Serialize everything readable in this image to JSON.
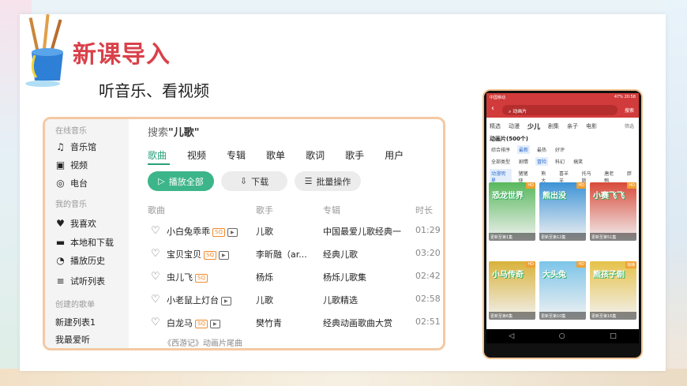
{
  "slide": {
    "title": "新课导入",
    "subtitle": "听音乐、看视频"
  },
  "music_app": {
    "sidebar": {
      "section_online": "在线音乐",
      "online_items": [
        {
          "label": "音乐馆",
          "icon": "music-note-icon"
        },
        {
          "label": "视频",
          "icon": "video-icon"
        },
        {
          "label": "电台",
          "icon": "radio-icon"
        }
      ],
      "section_mine": "我的音乐",
      "mine_items": [
        {
          "label": "我喜欢",
          "icon": "heart-icon"
        },
        {
          "label": "本地和下载",
          "icon": "monitor-icon"
        },
        {
          "label": "播放历史",
          "icon": "clock-icon"
        },
        {
          "label": "试听列表",
          "icon": "playlist-icon"
        }
      ],
      "section_created": "创建的歌单",
      "created_items": [
        "新建列表1",
        "我最爱听"
      ]
    },
    "search": {
      "prefix": "搜索",
      "query": "\"儿歌\""
    },
    "tabs": [
      "歌曲",
      "视频",
      "专辑",
      "歌单",
      "歌词",
      "歌手",
      "用户"
    ],
    "active_tab": "歌曲",
    "actions": {
      "play_all": "播放全部",
      "download": "下载",
      "batch": "批量操作"
    },
    "columns": {
      "song": "歌曲",
      "artist": "歌手",
      "album": "专辑",
      "duration": "时长"
    },
    "rows": [
      {
        "title": "小白兔乖乖",
        "sq": "SQ",
        "mv": "▶",
        "artist": "儿歌",
        "album": "中国最爱儿歌经典一",
        "duration": "01:29"
      },
      {
        "title": "宝贝宝贝",
        "sq": "SQ",
        "mv": "▶",
        "artist": "李昕融（ar...",
        "album": "经典儿歌",
        "duration": "03:20"
      },
      {
        "title": "虫儿飞",
        "sq": "SQ",
        "mv": "",
        "artist": "杨烁",
        "album": "杨烁儿歌集",
        "duration": "02:42"
      },
      {
        "title": "小老鼠上灯台",
        "sq": "",
        "mv": "▶",
        "artist": "儿歌",
        "album": "儿歌精选",
        "duration": "02:58"
      },
      {
        "title": "白龙马",
        "sq": "SQ",
        "mv": "▶",
        "artist": "樊竹青",
        "album": "经典动画歌曲大赏",
        "duration": "02:51"
      }
    ],
    "footnote": "《西游记》动画片尾曲"
  },
  "phone": {
    "status_left": "中国移动",
    "status_right": "47% 20:58",
    "search_text": "动画片",
    "search_button": "搜索",
    "tabs": [
      "精选",
      "动漫",
      "少儿",
      "剧集",
      "亲子",
      "电影"
    ],
    "active_tab": "少儿",
    "filter_label": "筛选",
    "result_title": "动画片(500个)",
    "sort_chips": [
      "综合排序",
      "最新",
      "最热",
      "好评"
    ],
    "type_chips": [
      "全部类型",
      "剧情",
      "冒险",
      "科幻",
      "搞笑"
    ],
    "series_chips": [
      "动漫明星",
      "猪猪侠",
      "熊大",
      "喜羊羊",
      "托马斯",
      "唐老鸭",
      "胖"
    ],
    "cards": [
      {
        "title": "恐龙世界",
        "tag": "HD",
        "caption": "更新至第1集",
        "color": "#58b85c"
      },
      {
        "title": "熊出没",
        "tag": "HD",
        "caption": "更新至第12集",
        "color": "#3d93d6"
      },
      {
        "title": "小赛飞飞",
        "tag": "HD",
        "caption": "更新至第51集",
        "color": "#d84a3a"
      },
      {
        "title": "小马传奇",
        "tag": "HD",
        "caption": "更新至第6集",
        "color": "#d8b23a"
      },
      {
        "title": "大头兔",
        "tag": "HD",
        "caption": "更新至第10集",
        "color": "#7cc4e8"
      },
      {
        "title": "熊孩子剧",
        "tag": "独播",
        "caption": "更新至第16集",
        "color": "#e6c24a"
      }
    ],
    "nav": [
      "◁",
      "○",
      "□"
    ]
  }
}
